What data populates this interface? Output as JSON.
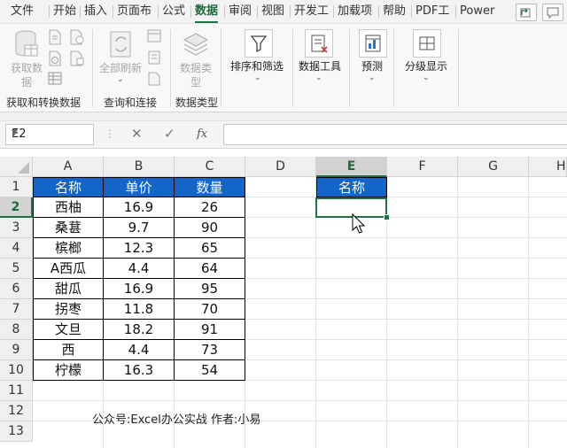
{
  "menu": {
    "items": [
      "文件",
      "开始",
      "插入",
      "页面布",
      "公式",
      "数据",
      "审阅",
      "视图",
      "开发工",
      "加载项",
      "帮助",
      "PDF工",
      "Power"
    ],
    "active": "数据"
  },
  "ribbon": {
    "get_data": {
      "line1": "获取数",
      "line2": "据"
    },
    "refresh_all": "全部刷新",
    "data_types": {
      "line1": "数据类",
      "line2": "型"
    },
    "sort_filter": "排序和筛选",
    "data_tools": "数据工具",
    "forecast": "预测",
    "outline": "分级显示",
    "groups": [
      "获取和转换数据",
      "查询和连接",
      "数据类型"
    ]
  },
  "formula_bar": {
    "name_box": "E2",
    "cancel_icon": "✕",
    "enter_icon": "✓",
    "fx_icon": "fx",
    "value": ""
  },
  "sheet": {
    "columns": [
      "A",
      "B",
      "C",
      "D",
      "E",
      "F",
      "G",
      "H"
    ],
    "rows": [
      "1",
      "2",
      "3",
      "4",
      "5",
      "6",
      "7",
      "8",
      "9",
      "10",
      "11",
      "12",
      "13"
    ],
    "selected_col": "E",
    "selected_row": "2",
    "table_header": [
      "名称",
      "单价",
      "数量"
    ],
    "table_rows": [
      [
        "西柚",
        "16.9",
        "26"
      ],
      [
        "桑葚",
        "9.7",
        "90"
      ],
      [
        "槟榔",
        "12.3",
        "65"
      ],
      [
        "A西瓜",
        "4.4",
        "64"
      ],
      [
        "甜瓜",
        "16.9",
        "95"
      ],
      [
        "拐枣",
        "11.8",
        "70"
      ],
      [
        "文旦",
        "18.2",
        "91"
      ],
      [
        "西",
        "4.4",
        "73"
      ],
      [
        "柠檬",
        "16.3",
        "54"
      ]
    ],
    "e1_header": "名称",
    "footnote": "公众号:Excel办公实战  作者:小易"
  },
  "colors": {
    "accent": "#217346",
    "header_fill": "#1366c7"
  }
}
